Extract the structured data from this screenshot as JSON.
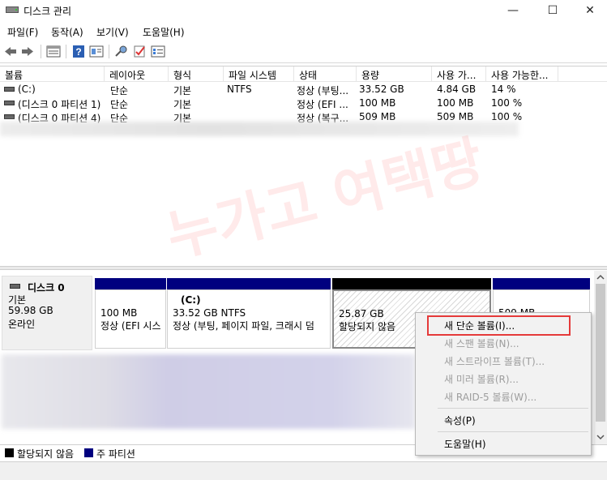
{
  "window": {
    "title": "디스크 관리",
    "minimize": "—",
    "maximize": "☐",
    "close": "✕"
  },
  "menu": [
    "파일(F)",
    "동작(A)",
    "보기(V)",
    "도움말(H)"
  ],
  "toolbar": {
    "icons": [
      "back-icon",
      "forward-icon",
      "list-view-icon",
      "help-icon",
      "properties-icon",
      "rescan-icon",
      "check-icon",
      "settings-list-icon"
    ]
  },
  "volumes": {
    "columns": [
      "볼륨",
      "레이아웃",
      "형식",
      "파일 시스템",
      "상태",
      "용량",
      "사용 가...",
      "사용 가능한..."
    ],
    "rows": [
      [
        "(C:)",
        "단순",
        "기본",
        "NTFS",
        "정상 (부팅...",
        "33.52 GB",
        "4.84 GB",
        "14 %"
      ],
      [
        "(디스크 0 파티션 1)",
        "단순",
        "기본",
        "",
        "정상 (EFI ...",
        "100 MB",
        "100 MB",
        "100 %"
      ],
      [
        "(디스크 0 파티션 4)",
        "단순",
        "기본",
        "",
        "정상 (복구...",
        "509 MB",
        "509 MB",
        "100 %"
      ]
    ]
  },
  "watermark": "누가고 여택땅",
  "disk0": {
    "name": "디스크 0",
    "type": "기본",
    "size": "59.98 GB",
    "status": "온라인"
  },
  "partitions": [
    {
      "line1": "",
      "line2": "100 MB",
      "line3": "정상 (EFI 시스"
    },
    {
      "line1": "(C:)",
      "line2": "33.52 GB NTFS",
      "line3": "정상 (부팅, 페이지 파일, 크래시 덤"
    },
    {
      "line1": "",
      "line2": "25.87 GB",
      "line3": "할당되지 않음"
    },
    {
      "line1": "",
      "line2": "509 MB",
      "line3": ""
    }
  ],
  "legend": {
    "unallocated": "할당되지 않음",
    "primary": "주 파티션"
  },
  "context_menu": {
    "items": [
      {
        "label": "새 단순 볼륨(I)...",
        "enabled": true
      },
      {
        "label": "새 스팬 볼륨(N)...",
        "enabled": false
      },
      {
        "label": "새 스트라이프 볼륨(T)...",
        "enabled": false
      },
      {
        "label": "새 미러 볼륨(R)...",
        "enabled": false
      },
      {
        "label": "새 RAID-5 볼륨(W)...",
        "enabled": false
      },
      {
        "label": "속성(P)",
        "enabled": true
      },
      {
        "label": "도움말(H)",
        "enabled": true
      }
    ]
  },
  "colors": {
    "partition_bar": "#00007f",
    "unallocated_bar": "#000000",
    "highlight": "#e53a3a"
  }
}
